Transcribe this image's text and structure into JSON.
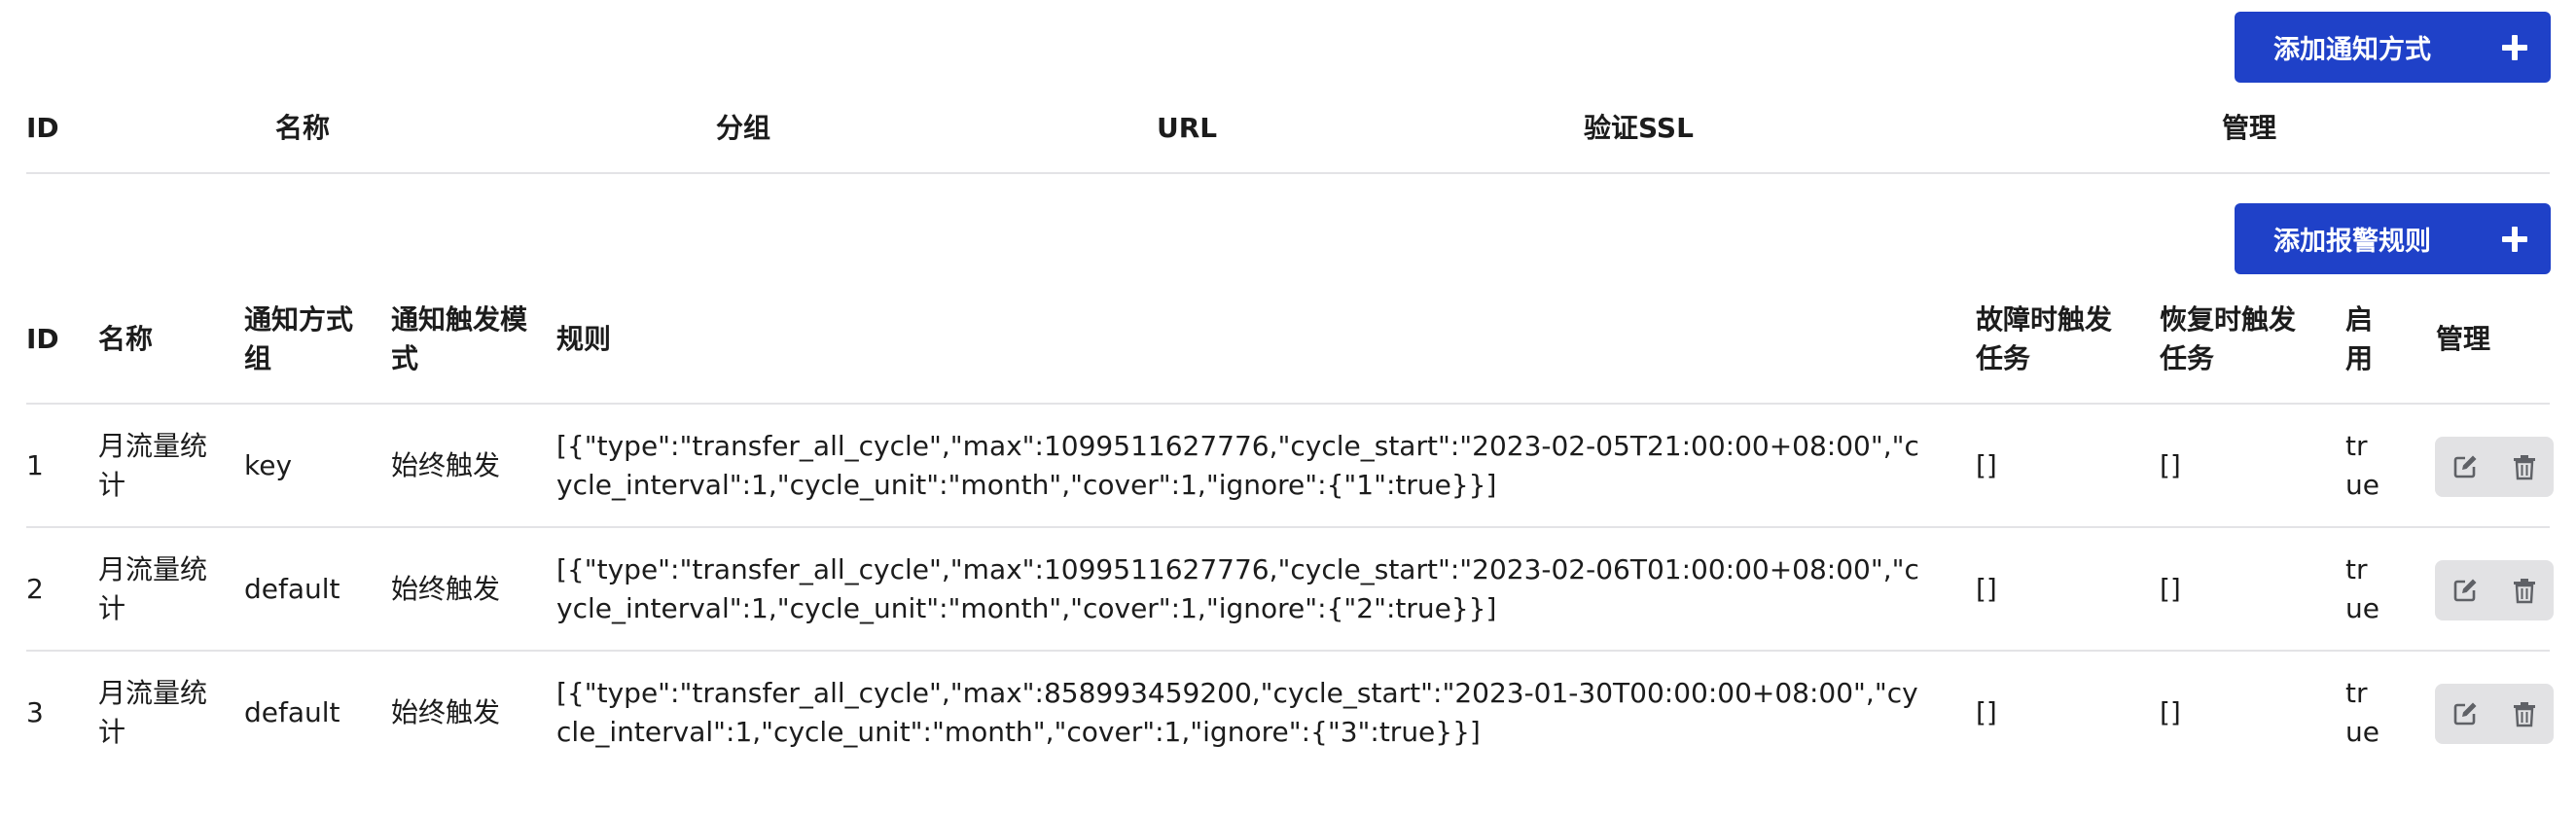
{
  "notifications": {
    "add_button_label": "添加通知方式",
    "columns": [
      "ID",
      "名称",
      "分组",
      "URL",
      "验证SSL",
      "管理"
    ]
  },
  "alert_rules": {
    "add_button_label": "添加报警规则",
    "columns": {
      "id": "ID",
      "name": "名称",
      "group": "通知方式组",
      "trigger_mode": "通知触发模式",
      "rules": "规则",
      "fail_task": "故障时触发任务",
      "recover_task": "恢复时触发任务",
      "enabled": "启用",
      "manage": "管理"
    },
    "rows": [
      {
        "id": "1",
        "name": "月流量统计",
        "group": "key",
        "trigger_mode": "始终触发",
        "rules": "[{\"type\":\"transfer_all_cycle\",\"max\":1099511627776,\"cycle_start\":\"2023-02-05T21:00:00+08:00\",\"cycle_interval\":1,\"cycle_unit\":\"month\",\"cover\":1,\"ignore\":{\"1\":true}}]",
        "fail_task": "[]",
        "recover_task": "[]",
        "enabled": "true"
      },
      {
        "id": "2",
        "name": "月流量统计",
        "group": "default",
        "trigger_mode": "始终触发",
        "rules": "[{\"type\":\"transfer_all_cycle\",\"max\":1099511627776,\"cycle_start\":\"2023-02-06T01:00:00+08:00\",\"cycle_interval\":1,\"cycle_unit\":\"month\",\"cover\":1,\"ignore\":{\"2\":true}}]",
        "fail_task": "[]",
        "recover_task": "[]",
        "enabled": "true"
      },
      {
        "id": "3",
        "name": "月流量统计",
        "group": "default",
        "trigger_mode": "始终触发",
        "rules": "[{\"type\":\"transfer_all_cycle\",\"max\":858993459200,\"cycle_start\":\"2023-01-30T00:00:00+08:00\",\"cycle_interval\":1,\"cycle_unit\":\"month\",\"cover\":1,\"ignore\":{\"3\":true}}]",
        "fail_task": "[]",
        "recover_task": "[]",
        "enabled": "true"
      }
    ]
  },
  "icons": {
    "edit": "edit-icon",
    "delete": "trash-icon",
    "add": "plus-icon"
  },
  "colors": {
    "primary": "#1f41c8",
    "divider": "#e3e3e6",
    "action_bg": "#e2e2e4",
    "icon": "#5f6166"
  }
}
